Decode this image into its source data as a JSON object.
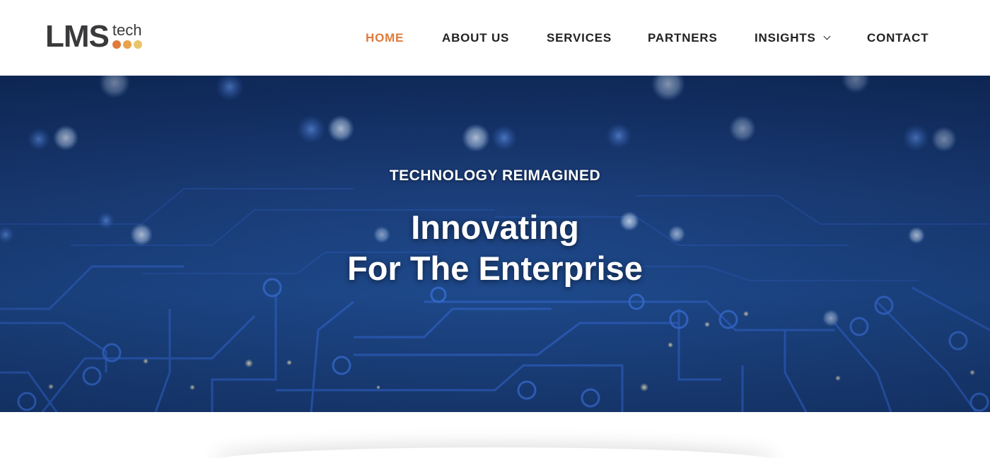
{
  "logo": {
    "main": "LMS",
    "sub": "tech",
    "dot_colors": [
      "#e07a3a",
      "#e8a24a",
      "#e9c56a"
    ]
  },
  "nav": {
    "items": [
      {
        "label": "HOME",
        "active": true
      },
      {
        "label": "ABOUT US",
        "active": false
      },
      {
        "label": "SERVICES",
        "active": false
      },
      {
        "label": "PARTNERS",
        "active": false
      },
      {
        "label": "INSIGHTS",
        "active": false,
        "has_dropdown": true
      },
      {
        "label": "CONTACT",
        "active": false
      }
    ]
  },
  "hero": {
    "eyebrow": "TECHNOLOGY REIMAGINED",
    "headline_line1": "Innovating",
    "headline_line2": "For The Enterprise",
    "background": "circuit-board-bokeh-image"
  },
  "colors": {
    "accent": "#e07a3a",
    "nav_text": "#222222",
    "hero_blue": "#1d4a8c"
  }
}
